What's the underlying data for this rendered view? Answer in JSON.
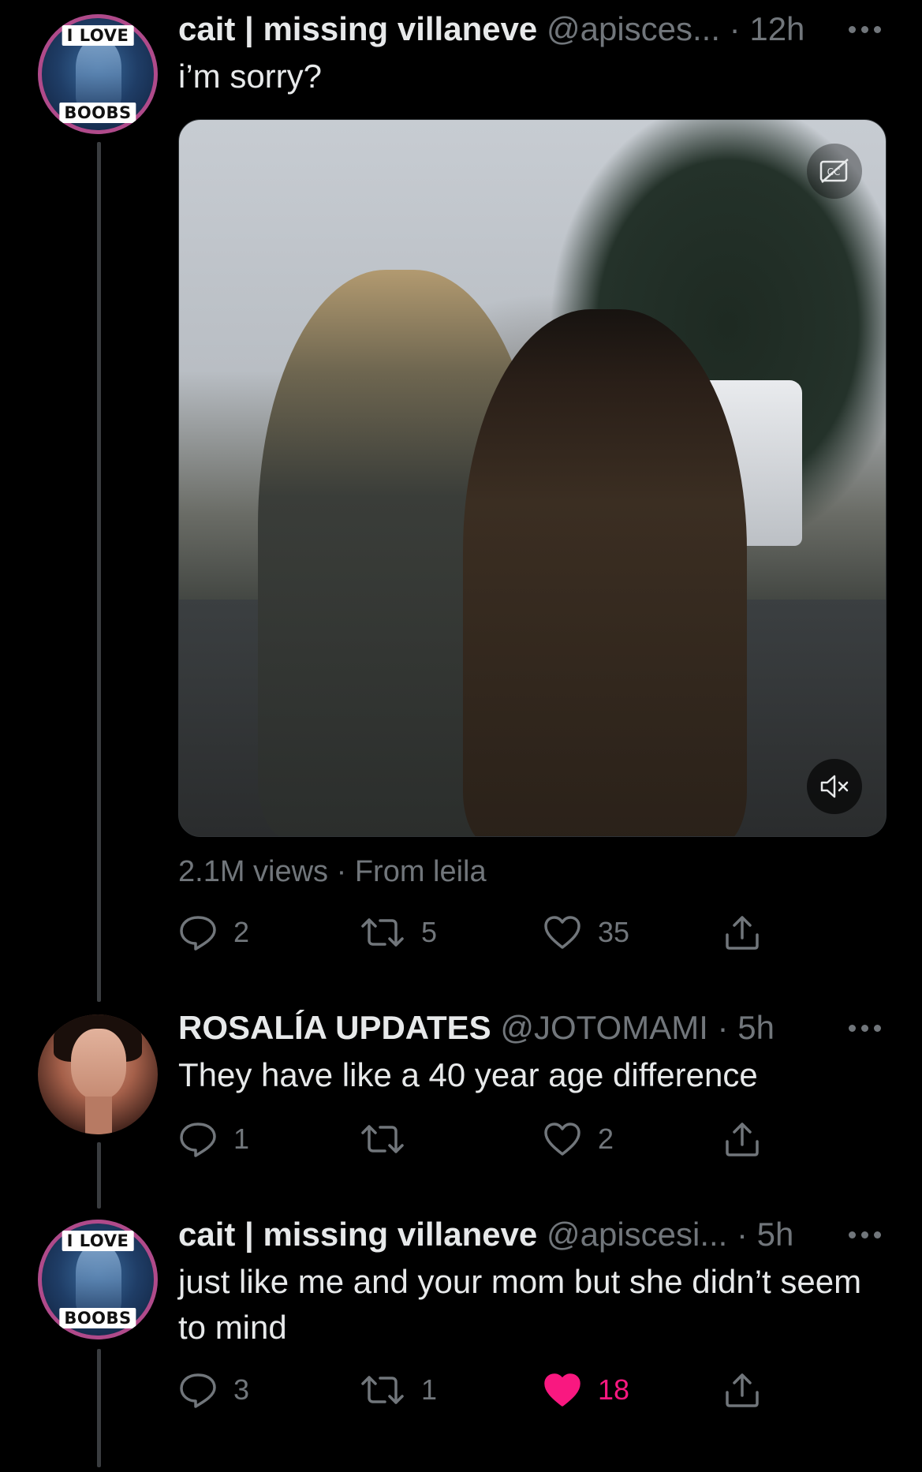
{
  "tweets": [
    {
      "name": "cait | missing villaneve",
      "handle_time": "@apisces... · 12h",
      "text": "i’m sorry?",
      "avatar": {
        "badge_top": "I LOVE",
        "badge_bottom": "BOOBS"
      },
      "media": {
        "views": "2.1M views · From leila",
        "cc_icon": "closed-captions-icon",
        "mute_icon": "muted-speaker-icon"
      },
      "actions": {
        "reply": "2",
        "retweet": "5",
        "like": "35",
        "share": ""
      }
    },
    {
      "name": "ROSALÍA UPDATES",
      "handle_time": "@JOTOMAMI · 5h",
      "text": "They have like a 40 year age difference",
      "actions": {
        "reply": "1",
        "retweet": "",
        "like": "2",
        "share": ""
      }
    },
    {
      "name": "cait | missing villaneve",
      "handle_time": "@apiscesi... · 5h",
      "text": "just like me and your mom but she didn’t seem to mind",
      "avatar": {
        "badge_top": "I LOVE",
        "badge_bottom": "BOOBS"
      },
      "actions": {
        "reply": "3",
        "retweet": "1",
        "like": "18",
        "share": ""
      },
      "liked": true
    }
  ],
  "colors": {
    "background": "#000000",
    "text": "#e7e9ea",
    "muted": "#71767b",
    "like_active": "#f91880",
    "thread_line": "#3a3d40"
  }
}
